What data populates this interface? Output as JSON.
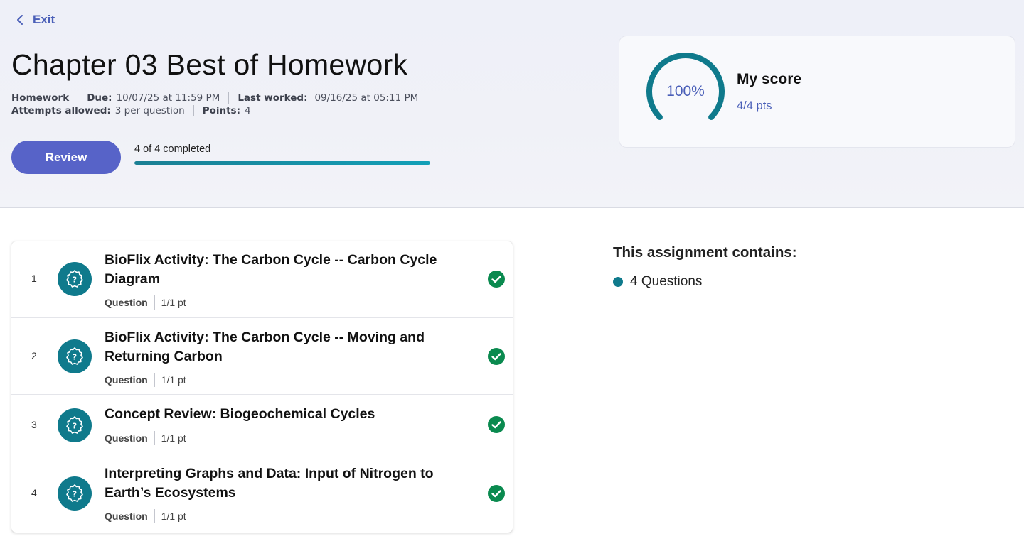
{
  "header": {
    "exit_label": "Exit",
    "title": "Chapter 03 Best of Homework",
    "meta": {
      "type": "Homework",
      "due_label": "Due:",
      "due_value": "10/07/25 at 11:59 PM",
      "last_worked_label": "Last worked:",
      "last_worked_value": "09/16/25 at 05:11 PM",
      "attempts_label": "Attempts allowed:",
      "attempts_value": "3 per question",
      "points_label": "Points:",
      "points_value": "4"
    },
    "review_label": "Review",
    "progress_text": "4 of 4 completed",
    "progress_fraction": 1.0
  },
  "score": {
    "percent_text": "100%",
    "percent_value": 100,
    "title": "My score",
    "points_text": "4/4 pts"
  },
  "questions": [
    {
      "number": "1",
      "title": "BioFlix Activity: The Carbon Cycle -- Carbon Cycle Diagram",
      "type": "Question",
      "points": "1/1 pt",
      "status": "complete"
    },
    {
      "number": "2",
      "title": "BioFlix Activity: The Carbon Cycle -- Moving and Returning Carbon",
      "type": "Question",
      "points": "1/1 pt",
      "status": "complete"
    },
    {
      "number": "3",
      "title": "Concept Review: Biogeochemical Cycles",
      "type": "Question",
      "points": "1/1 pt",
      "status": "complete"
    },
    {
      "number": "4",
      "title": "Interpreting Graphs and Data: Input of Nitrogen to Earth’s Ecosystems",
      "type": "Question",
      "points": "1/1 pt",
      "status": "complete"
    }
  ],
  "contains": {
    "title": "This assignment contains:",
    "items": [
      "4 Questions"
    ]
  },
  "icons": {
    "exit": "chevron-left-icon",
    "question": "question-badge-icon",
    "status": "check-circle-icon"
  },
  "colors": {
    "accent": "#4a5fb8",
    "button": "#5763c8",
    "teal": "#0f7a8c",
    "success": "#0a8a4f"
  }
}
